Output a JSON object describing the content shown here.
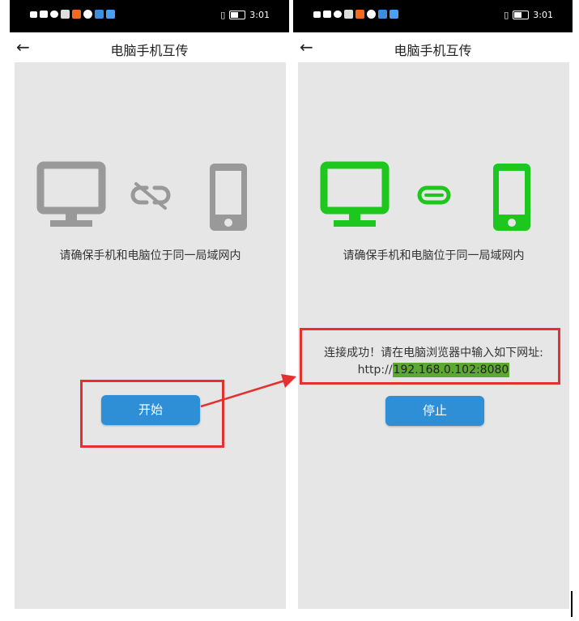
{
  "status_time": "3:01",
  "header": {
    "title": "电脑手机互传",
    "back_symbol": "←"
  },
  "left_screen": {
    "hint": "请确保手机和电脑位于同一局域网内",
    "button_label": "开始",
    "icon_color": "#999999"
  },
  "right_screen": {
    "hint": "请确保手机和电脑位于同一局域网内",
    "success_text": "连接成功！请在电脑浏览器中输入如下网址:",
    "url_prefix": "http://",
    "url_highlight": "192.168.0.102:8080",
    "button_label": "停止",
    "icon_color": "#1ec71e"
  },
  "colors": {
    "button": "#2f8fd6",
    "annotation": "#e53030",
    "highlight": "#5da830"
  }
}
